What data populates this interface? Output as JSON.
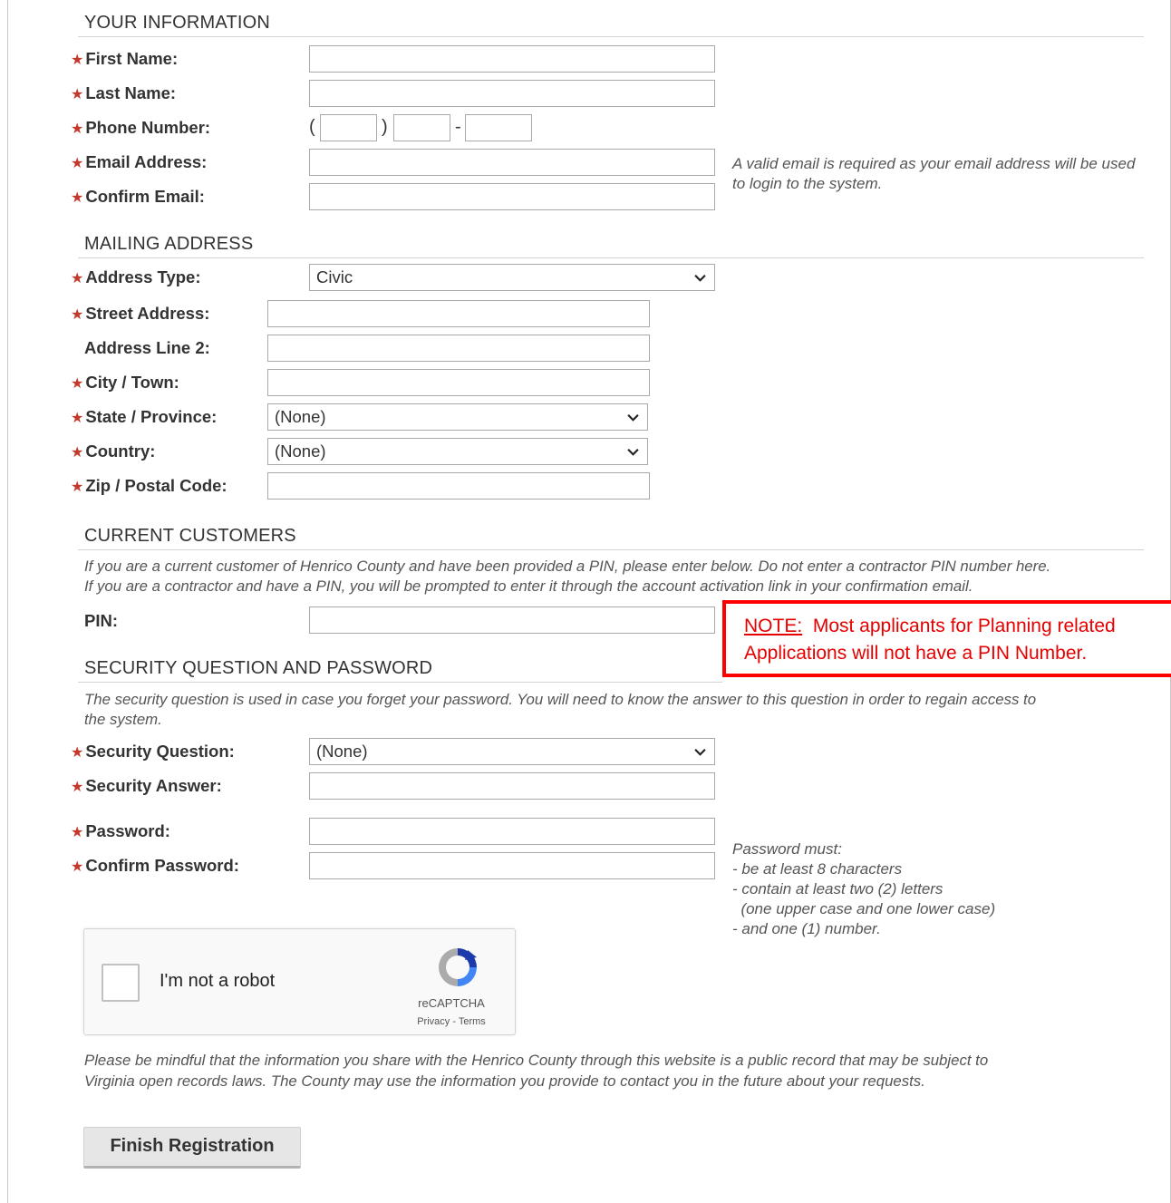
{
  "required_marker": "★",
  "your_information": {
    "title": "YOUR INFORMATION",
    "first_name_label": "First Name:",
    "last_name_label": "Last Name:",
    "phone_label": "Phone Number:",
    "phone_open_paren": "(",
    "phone_close_paren": ")",
    "phone_dash": "-",
    "email_label": "Email Address:",
    "confirm_email_label": "Confirm Email:",
    "email_hint": "A valid email is required as your email address will be used to login to the system."
  },
  "mailing_address": {
    "title": "MAILING ADDRESS",
    "address_type_label": "Address Type:",
    "address_type_value": "Civic",
    "street_label": "Street Address:",
    "line2_label": "Address Line 2:",
    "city_label": "City / Town:",
    "state_label": "State / Province:",
    "state_value": "(None)",
    "country_label": "Country:",
    "country_value": "(None)",
    "zip_label": "Zip / Postal Code:"
  },
  "current_customers": {
    "title": "CURRENT CUSTOMERS",
    "description_line1": "If you are a current customer of Henrico County and have been provided a PIN, please enter below. Do not enter a contractor PIN number here.",
    "description_line2": "If you are a contractor and have a PIN, you will be prompted to enter it through the account activation link in your confirmation email.",
    "pin_label": "PIN:"
  },
  "note": {
    "label": "NOTE:",
    "line1": "Most applicants for Planning related",
    "line2": "Applications will not have a PIN Number."
  },
  "security": {
    "title": "SECURITY QUESTION AND PASSWORD",
    "description_line1": "The security question is used in case you forget your password. You will need to know the answer to this question in order to regain access to",
    "description_line2": "the system.",
    "question_label": "Security Question:",
    "question_value": "(None)",
    "answer_label": "Security Answer:",
    "password_label": "Password:",
    "confirm_password_label": "Confirm Password:",
    "password_rules": [
      "Password must:",
      "- be at least 8 characters",
      "- contain at least two (2) letters",
      "  (one upper case and one lower case)",
      "- and one (1) number."
    ]
  },
  "captcha": {
    "label": "I'm not a robot",
    "brand": "reCAPTCHA",
    "links": "Privacy - Terms",
    "icon": "recaptcha-logo"
  },
  "disclaimer": {
    "line1": "Please be mindful that the information you share with the Henrico County through this website is a public record that may be subject to",
    "line2": "Virginia open records laws. The County may use the information you provide to contact you in the future about your requests."
  },
  "finish_button_label": "Finish Registration",
  "colors": {
    "required": "#c0392b",
    "note": "#e60000",
    "note_border": "#ff0000"
  }
}
